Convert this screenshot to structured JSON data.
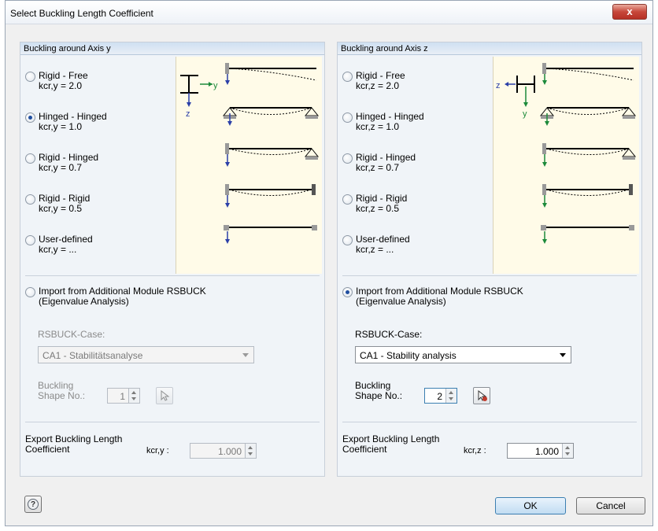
{
  "window": {
    "title": "Select Buckling Length Coefficient",
    "close": "x"
  },
  "left": {
    "header": "Buckling around Axis y",
    "options": [
      {
        "line1": "Rigid - Free",
        "line2": "kcr,y = 2.0",
        "selected": false
      },
      {
        "line1": "Hinged - Hinged",
        "line2": "kcr,y = 1.0",
        "selected": true
      },
      {
        "line1": "Rigid - Hinged",
        "line2": "kcr,y = 0.7",
        "selected": false
      },
      {
        "line1": "Rigid - Rigid",
        "line2": "kcr,y = 0.5",
        "selected": false
      },
      {
        "line1": "User-defined",
        "line2": "kcr,y = ...",
        "selected": false
      }
    ],
    "axis_label_main": "y",
    "axis_label_vert": "z",
    "import": {
      "line1": "Import from Additional Module RSBUCK",
      "line2": "(Eigenvalue Analysis)",
      "selected": false
    },
    "case_label": "RSBUCK-Case:",
    "case_value": "CA1 - Stabilitätsanalyse",
    "shape_label1": "Buckling",
    "shape_label2": "Shape No.:",
    "shape_value": "1",
    "export_label1": "Export Buckling Length",
    "export_label2": "Coefficient",
    "export_sym": "kcr,y :",
    "export_value": "1.000"
  },
  "right": {
    "header": "Buckling around Axis z",
    "options": [
      {
        "line1": "Rigid - Free",
        "line2": "kcr,z = 2.0",
        "selected": false
      },
      {
        "line1": "Hinged - Hinged",
        "line2": "kcr,z = 1.0",
        "selected": false
      },
      {
        "line1": "Rigid - Hinged",
        "line2": "kcr,z = 0.7",
        "selected": false
      },
      {
        "line1": "Rigid - Rigid",
        "line2": "kcr,z = 0.5",
        "selected": false
      },
      {
        "line1": "User-defined",
        "line2": "kcr,z = ...",
        "selected": false
      }
    ],
    "axis_label_main": "z",
    "axis_label_vert": "y",
    "import": {
      "line1": "Import from Additional Module RSBUCK",
      "line2": "(Eigenvalue Analysis)",
      "selected": true
    },
    "case_label": "RSBUCK-Case:",
    "case_value": "CA1 - Stability analysis",
    "shape_label1": "Buckling",
    "shape_label2": "Shape No.:",
    "shape_value": "2",
    "export_label1": "Export Buckling Length",
    "export_label2": "Coefficient",
    "export_sym": "kcr,z :",
    "export_value": "1.000"
  },
  "buttons": {
    "ok": "OK",
    "cancel": "Cancel",
    "help_icon": "question-mark-icon"
  },
  "colors": {
    "selected_radio": "#1f4ea0",
    "diagram_bg": "#fffbe8",
    "axis_blue": "#2b3fa8",
    "axis_green": "#1c8a3a"
  }
}
